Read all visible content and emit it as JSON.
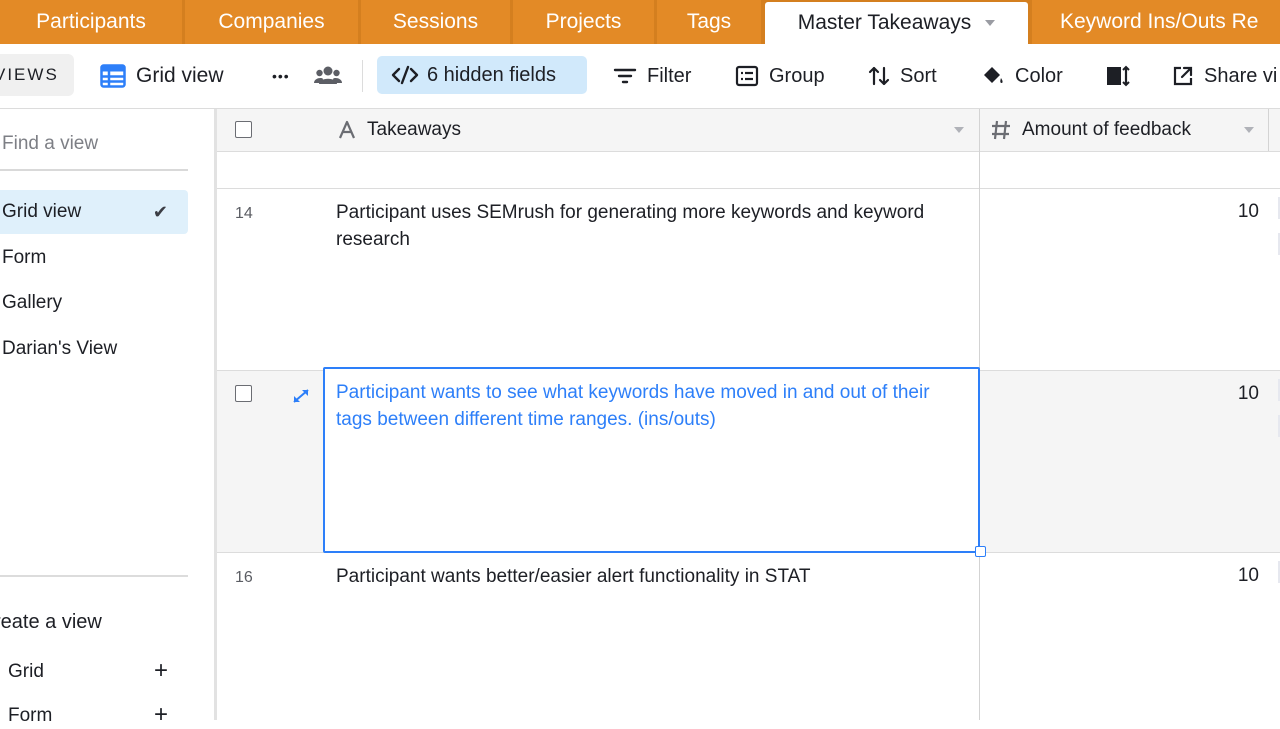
{
  "tabs": [
    {
      "label": "Participants"
    },
    {
      "label": "Companies"
    },
    {
      "label": "Sessions"
    },
    {
      "label": "Projects"
    },
    {
      "label": "Tags"
    },
    {
      "label": "Master Takeaways",
      "active": true
    },
    {
      "label": "Keyword Ins/Outs Re"
    }
  ],
  "toolbar": {
    "views_label": "VIEWS",
    "view_name": "Grid view",
    "more_label": "•••",
    "hidden_fields": "6 hidden fields",
    "filter": "Filter",
    "group": "Group",
    "sort": "Sort",
    "color": "Color",
    "share": "Share vi"
  },
  "sidebar": {
    "search_placeholder": "Find a view",
    "views": [
      {
        "label": "Grid view",
        "selected": true
      },
      {
        "label": "Form"
      },
      {
        "label": "Gallery"
      },
      {
        "label": "Darian's View"
      }
    ],
    "create_title": "reate a view",
    "create_items": [
      {
        "label": "Grid",
        "plus": "+"
      },
      {
        "label": "Form",
        "plus": "+"
      }
    ]
  },
  "grid": {
    "columns": [
      {
        "label": "Takeaways",
        "icon": "text-field-icon"
      },
      {
        "label": "Amount of feedback",
        "icon": "number-field-icon"
      }
    ],
    "rows": [
      {
        "num": "14",
        "takeaway": "Participant uses SEMrush for generating more keywords and keyword research",
        "amount": "10"
      },
      {
        "num": "",
        "takeaway": "Participant wants to see what keywords have moved in and out of their tags between different time ranges. (ins/outs)",
        "amount": "10",
        "selected": true
      },
      {
        "num": "16",
        "takeaway": "Participant wants better/easier alert functionality in STAT",
        "amount": "10"
      }
    ]
  },
  "colors": {
    "tab_bar": "#e38a26",
    "accent_blue": "#2d7ff9",
    "hidden_fields_bg": "#d1e9fb",
    "selected_view_bg": "#dff0fb"
  }
}
